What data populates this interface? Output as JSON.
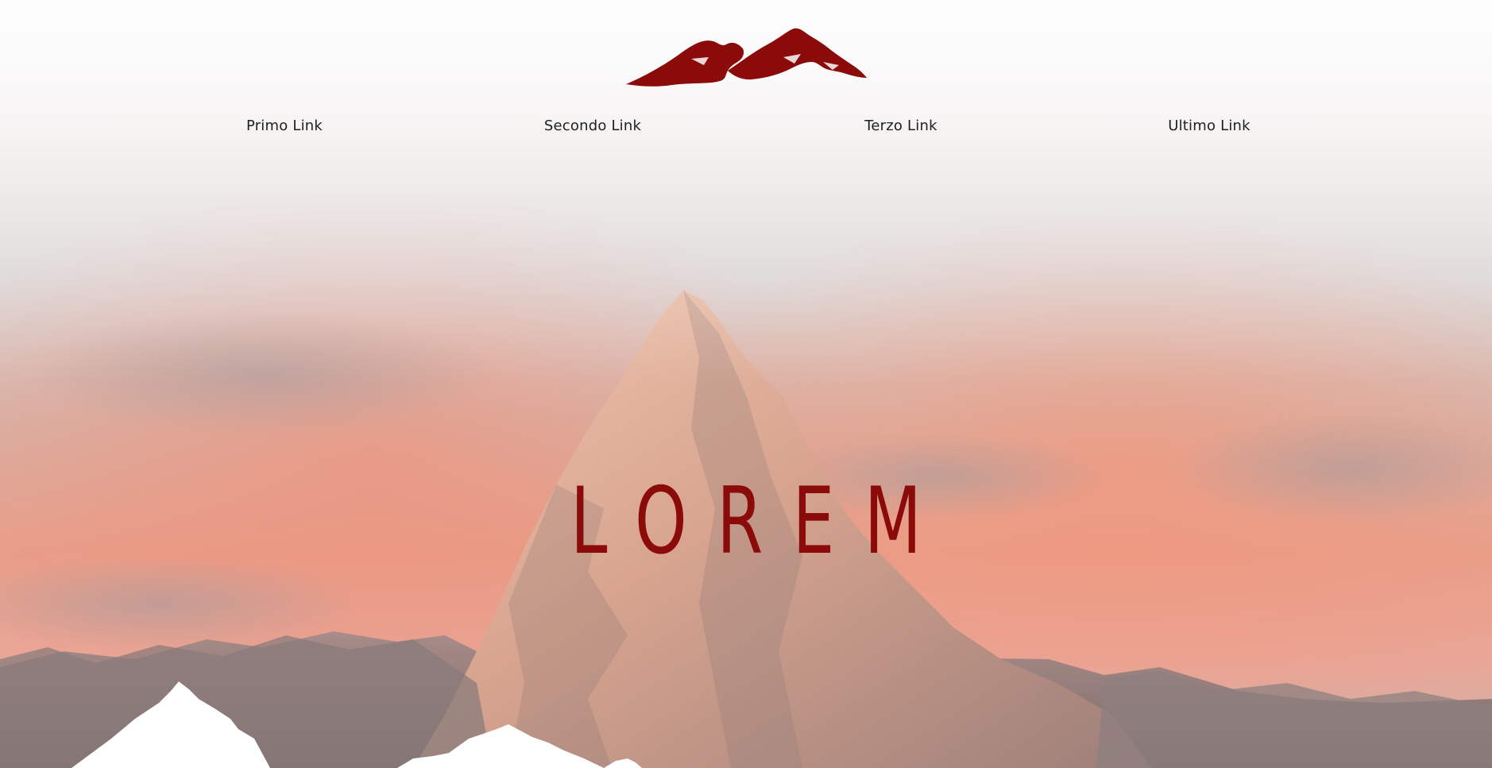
{
  "header": {
    "logo_icon": "mountains-logo-icon",
    "brand_color": "#8b0a0a"
  },
  "nav": {
    "items": [
      {
        "label": "Primo Link"
      },
      {
        "label": "Secondo Link"
      },
      {
        "label": "Terzo Link"
      },
      {
        "label": "Ultimo Link"
      }
    ]
  },
  "hero": {
    "title": "LOREM",
    "background_icon": "mountain-peak-image",
    "foreground_icon": "white-peaks-silhouette-icon"
  }
}
